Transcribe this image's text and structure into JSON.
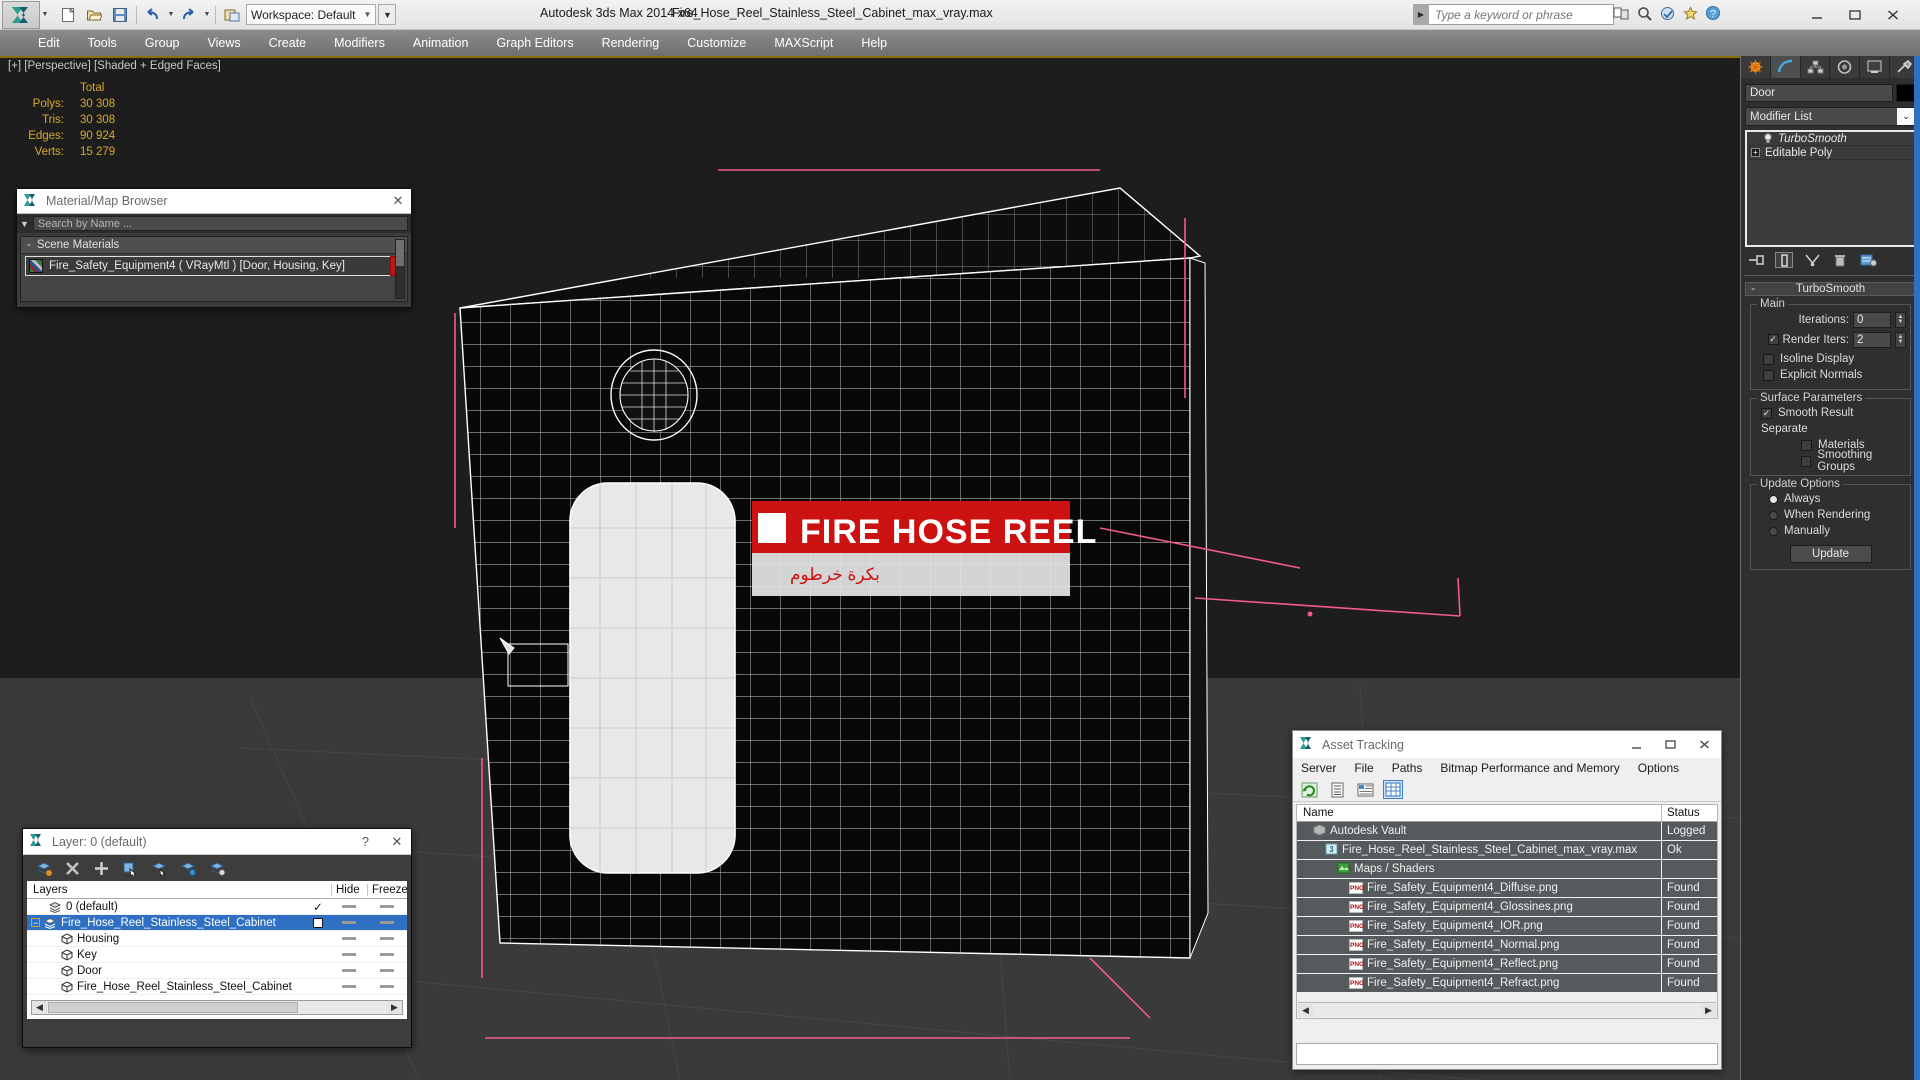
{
  "titlebar": {
    "app_title": "Autodesk 3ds Max  2014 x64",
    "file_title": "Fire_Hose_Reel_Stainless_Steel_Cabinet_max_vray.max",
    "workspace_label": "Workspace: Default",
    "search_placeholder": "Type a keyword or phrase",
    "quick_access": [
      "new-icon",
      "open-icon",
      "save-icon",
      "undo-icon",
      "redo-icon",
      "set-project-icon"
    ],
    "window_buttons": [
      "minimize",
      "maximize",
      "close"
    ]
  },
  "menubar": {
    "items": [
      "Edit",
      "Tools",
      "Group",
      "Views",
      "Create",
      "Modifiers",
      "Animation",
      "Graph Editors",
      "Rendering",
      "Customize",
      "MAXScript",
      "Help"
    ]
  },
  "viewport": {
    "label": "[+] [Perspective] [Shaded + Edged Faces]",
    "stats": {
      "header": "Total",
      "rows": [
        {
          "label": "Polys:",
          "value": "30 308"
        },
        {
          "label": "Tris:",
          "value": "30 308"
        },
        {
          "label": "Edges:",
          "value": "90 924"
        },
        {
          "label": "Verts:",
          "value": "15 279"
        }
      ]
    },
    "decal_text": "FIRE HOSE REEL"
  },
  "material_browser": {
    "title": "Material/Map Browser",
    "search_placeholder": "Search by Name ...",
    "group_label": "Scene Materials",
    "items": [
      {
        "label": "Fire_Safety_Equipment4  ( VRayMtl )  [Door, Housing, Key]"
      }
    ]
  },
  "layer_dialog": {
    "title": "Layer: 0 (default)",
    "help_label": "?",
    "columns": [
      "Layers",
      "Hide",
      "Freeze"
    ],
    "rows": [
      {
        "name": "0 (default)",
        "indent": 1,
        "icon": "layers-icon",
        "selected": false,
        "check": "✓",
        "hide": "dash",
        "freeze": "dash"
      },
      {
        "name": "Fire_Hose_Reel_Stainless_Steel_Cabinet",
        "indent": 0,
        "icon": "layers-icon",
        "selected": true,
        "check": "box",
        "hide": "dash",
        "freeze": "dash"
      },
      {
        "name": "Housing",
        "indent": 2,
        "icon": "object-icon",
        "selected": false,
        "check": "",
        "hide": "dash",
        "freeze": "dash"
      },
      {
        "name": "Key",
        "indent": 2,
        "icon": "object-icon",
        "selected": false,
        "check": "",
        "hide": "dash",
        "freeze": "dash"
      },
      {
        "name": "Door",
        "indent": 2,
        "icon": "object-icon",
        "selected": false,
        "check": "",
        "hide": "dash",
        "freeze": "dash"
      },
      {
        "name": "Fire_Hose_Reel_Stainless_Steel_Cabinet",
        "indent": 2,
        "icon": "object-icon",
        "selected": false,
        "check": "",
        "hide": "dash",
        "freeze": "dash"
      }
    ],
    "toolbar_icons": [
      "new-layer-icon",
      "delete-layer-icon",
      "add-layer-icon",
      "select-objects-icon",
      "select-highlighted-icon",
      "highlight-selected-icon",
      "layer-properties-icon"
    ]
  },
  "asset_tracking": {
    "title": "Asset Tracking",
    "menus": [
      "Server",
      "File",
      "Paths",
      "Bitmap Performance and Memory",
      "Options"
    ],
    "toolbar_icons": [
      "refresh-icon",
      "list-view-icon",
      "details-view-icon",
      "grid-view-icon"
    ],
    "columns": [
      "Name",
      "Status"
    ],
    "rows": [
      {
        "name": "Autodesk Vault",
        "status": "Logged",
        "icon": "vault-icon",
        "indent": 1
      },
      {
        "name": "Fire_Hose_Reel_Stainless_Steel_Cabinet_max_vray.max",
        "status": "Ok",
        "icon": "max-icon",
        "indent": 2
      },
      {
        "name": "Maps / Shaders",
        "status": "",
        "icon": "maps-icon",
        "indent": 3
      },
      {
        "name": "Fire_Safety_Equipment4_Diffuse.png",
        "status": "Found",
        "icon": "png-icon",
        "indent": 4
      },
      {
        "name": "Fire_Safety_Equipment4_Glossines.png",
        "status": "Found",
        "icon": "png-icon",
        "indent": 4
      },
      {
        "name": "Fire_Safety_Equipment4_IOR.png",
        "status": "Found",
        "icon": "png-icon",
        "indent": 4
      },
      {
        "name": "Fire_Safety_Equipment4_Normal.png",
        "status": "Found",
        "icon": "png-icon",
        "indent": 4
      },
      {
        "name": "Fire_Safety_Equipment4_Reflect.png",
        "status": "Found",
        "icon": "png-icon",
        "indent": 4
      },
      {
        "name": "Fire_Safety_Equipment4_Refract.png",
        "status": "Found",
        "icon": "png-icon",
        "indent": 4
      }
    ]
  },
  "command_panel": {
    "tabs": [
      "create-tab",
      "modify-tab",
      "hierarchy-tab",
      "motion-tab",
      "display-tab",
      "utilities-tab"
    ],
    "object_name": "Door",
    "object_color": "#000000",
    "modifier_list_label": "Modifier List",
    "stack": [
      {
        "label": "TurboSmooth",
        "italic": true,
        "icon": "light-bulb-icon"
      },
      {
        "label": "Editable Poly",
        "italic": false,
        "icon": "plus-box-icon"
      }
    ],
    "stack_tools": [
      "pin-stack-icon",
      "show-end-result-icon",
      "make-unique-icon",
      "remove-modifier-icon",
      "configure-sets-icon"
    ],
    "rollout": {
      "title": "TurboSmooth",
      "main_group": "Main",
      "iterations_label": "Iterations:",
      "iterations_value": "0",
      "render_iters_label": "Render Iters:",
      "render_iters_value": "2",
      "render_iters_checked": true,
      "isoline_label": "Isoline Display",
      "isoline_checked": false,
      "explicit_normals_label": "Explicit Normals",
      "explicit_normals_checked": false,
      "surface_group": "Surface Parameters",
      "smooth_result_label": "Smooth Result",
      "smooth_result_checked": true,
      "separate_label": "Separate",
      "materials_label": "Materials",
      "materials_checked": false,
      "smoothing_groups_label": "Smoothing Groups",
      "smoothing_groups_checked": false,
      "update_group": "Update Options",
      "update_options": [
        {
          "label": "Always",
          "selected": true
        },
        {
          "label": "When Rendering",
          "selected": false
        },
        {
          "label": "Manually",
          "selected": false
        }
      ],
      "update_button": "Update"
    }
  },
  "colors": {
    "accent_blue": "#2f6fc4",
    "stat_yellow": "#d8a92a",
    "decal_red": "#cc1111",
    "gizmo_pink": "#f25a8e"
  }
}
